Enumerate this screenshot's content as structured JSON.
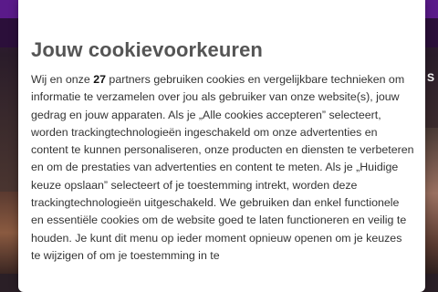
{
  "background": {
    "side_text": "S"
  },
  "modal": {
    "title": "Jouw cookievoorkeuren",
    "body_before_count": "Wij en onze ",
    "partner_count": "27",
    "body_after_count": " partners gebruiken cookies en vergelijkbare technieken om informatie te verzamelen over jou als gebruiker van onze website(s), jouw gedrag en jouw apparaten. Als je „Alle cookies accepteren” selecteert, worden trackingtechnologieën ingeschakeld om onze advertenties en content te kunnen personaliseren, onze producten en diensten te verbeteren en om de prestaties van advertenties en content te meten. Als je „Huidige keuze opslaan” selecteert of je toestemming intrekt, worden deze trackingtechnologieën uitgeschakeld. We gebruiken dan enkel functionele en essentiële cookies om de website goed te laten functioneren en veilig te houden. Je kunt dit menu op ieder moment opnieuw openen om je keuzes te wijzigen of om je toestemming in te"
  },
  "colors": {
    "title": "#555555",
    "body_text": "#333333",
    "modal_bg": "#ffffff",
    "top_bar": "#2b0f3a"
  }
}
